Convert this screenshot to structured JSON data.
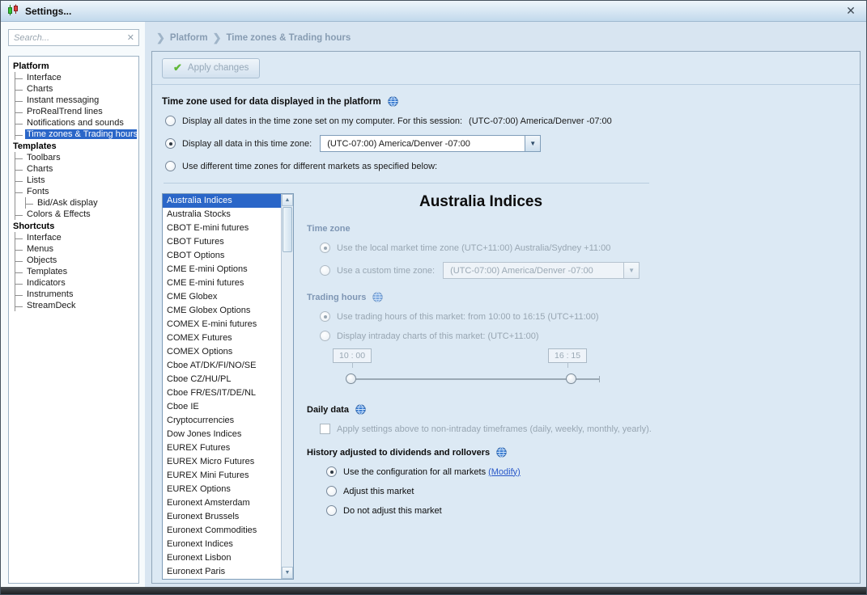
{
  "window": {
    "title": "Settings..."
  },
  "icons": {
    "close": "✕",
    "search_clear": "✕",
    "apply_check": "✔",
    "breadcrumb_chevron": "❯",
    "combo_arrow": "▼",
    "scroll_up": "▲",
    "scroll_down": "▼"
  },
  "sidebar": {
    "search_placeholder": "Search...",
    "groups": [
      {
        "label": "Platform",
        "items": [
          {
            "label": "Interface"
          },
          {
            "label": "Charts"
          },
          {
            "label": "Instant messaging"
          },
          {
            "label": "ProRealTrend lines"
          },
          {
            "label": "Notifications and sounds"
          },
          {
            "label": "Time zones & Trading hours",
            "selected": true
          }
        ]
      },
      {
        "label": "Templates",
        "items": [
          {
            "label": "Toolbars"
          },
          {
            "label": "Charts"
          },
          {
            "label": "Lists"
          },
          {
            "label": "Fonts"
          },
          {
            "label": "Bid/Ask display",
            "nested": true
          },
          {
            "label": "Colors & Effects"
          }
        ]
      },
      {
        "label": "Shortcuts",
        "items": [
          {
            "label": "Interface"
          },
          {
            "label": "Menus"
          },
          {
            "label": "Objects"
          },
          {
            "label": "Templates"
          },
          {
            "label": "Indicators"
          },
          {
            "label": "Instruments"
          },
          {
            "label": "StreamDeck"
          }
        ]
      }
    ]
  },
  "breadcrumb": {
    "items": [
      "Platform",
      "Time zones & Trading hours"
    ]
  },
  "toolbar": {
    "apply_label": "Apply changes"
  },
  "timezone_section": {
    "title": "Time zone used for data displayed in the platform",
    "options": {
      "computer_label": "Display all dates in the time zone set on my computer. For this session:",
      "computer_value": "(UTC-07:00) America/Denver -07:00",
      "custom_label": "Display all data in this time zone:",
      "custom_value": "(UTC-07:00) America/Denver -07:00",
      "per_market_label": "Use different time zones for different markets as specified below:"
    }
  },
  "market_list": {
    "selected": "Australia Indices",
    "items": [
      "Australia Indices",
      "Australia Stocks",
      "CBOT E-mini futures",
      "CBOT Futures",
      "CBOT Options",
      "CME E-mini Options",
      "CME E-mini futures",
      "CME Globex",
      "CME Globex Options",
      "COMEX E-mini futures",
      "COMEX Futures",
      "COMEX Options",
      "Cboe AT/DK/FI/NO/SE",
      "Cboe CZ/HU/PL",
      "Cboe FR/ES/IT/DE/NL",
      "Cboe IE",
      "Cryptocurrencies",
      "Dow Jones Indices",
      "EUREX Futures",
      "EUREX Micro Futures",
      "EUREX Mini Futures",
      "EUREX Options",
      "Euronext Amsterdam",
      "Euronext Brussels",
      "Euronext Commodities",
      "Euronext Indices",
      "Euronext Lisbon",
      "Euronext Paris"
    ]
  },
  "market_detail": {
    "title": "Australia Indices",
    "time_zone": {
      "label": "Time zone",
      "local_option": "Use the local market time zone (UTC+11:00) Australia/Sydney +11:00",
      "custom_option": "Use a custom time zone:",
      "custom_value": "(UTC-07:00) America/Denver -07:00"
    },
    "trading_hours": {
      "label": "Trading hours",
      "market_hours_option": "Use trading hours of this market: from 10:00 to 16:15  (UTC+11:00)",
      "intraday_option": "Display intraday charts of this market:  (UTC+11:00)",
      "slider_from": "10 : 00",
      "slider_to": "16 : 15"
    },
    "daily_data": {
      "label": "Daily data",
      "apply_option": "Apply settings above to non-intraday timeframes (daily, weekly, monthly, yearly)."
    },
    "history": {
      "label": "History adjusted to dividends and rollovers",
      "all_markets_option": "Use the configuration for all markets",
      "modify_link": "(Modify)",
      "adjust_option": "Adjust this market",
      "no_adjust_option": "Do not adjust this market"
    }
  }
}
